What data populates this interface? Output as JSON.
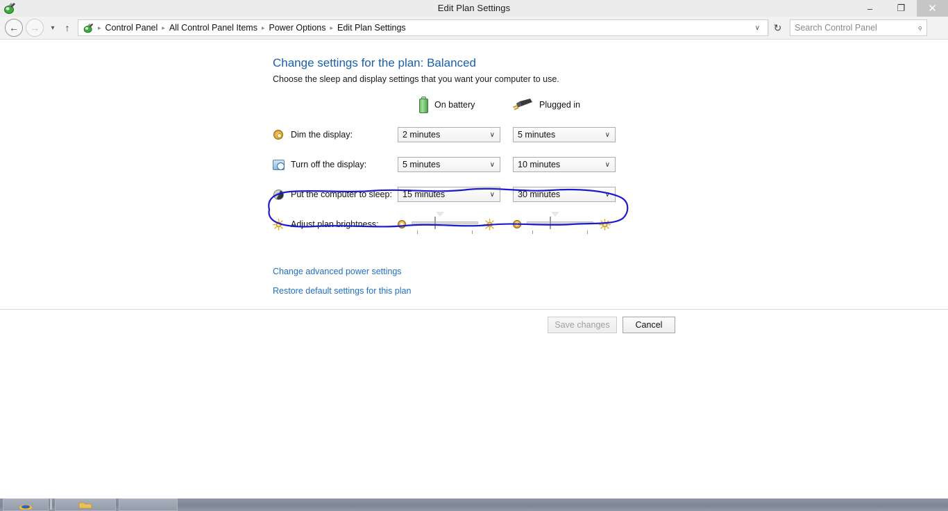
{
  "window": {
    "title": "Edit Plan Settings",
    "icon": "power-options-icon",
    "minimize_label": "–",
    "maximize_label": "❐",
    "close_label": "✕"
  },
  "navbar": {
    "back_label": "←",
    "forward_label": "→",
    "recent_caret_label": "▾",
    "up_label": "↑",
    "breadcrumb_icon": "power-options-icon",
    "breadcrumbs": [
      "Control Panel",
      "All Control Panel Items",
      "Power Options",
      "Edit Plan Settings"
    ],
    "separator": "▸",
    "address_dropdown_label": "∨",
    "refresh_label": "↻",
    "search_placeholder": "Search Control Panel",
    "search_value": "",
    "search_icon": "search-icon"
  },
  "content": {
    "heading": "Change settings for the plan: Balanced",
    "subheading": "Choose the sleep and display settings that you want your computer to use.",
    "columns": [
      {
        "label": "On battery",
        "icon": "battery-icon"
      },
      {
        "label": "Plugged in",
        "icon": "power-plug-icon"
      }
    ],
    "rows": [
      {
        "label": "Dim the display:",
        "icon": "dim-display-icon",
        "battery_value": "2 minutes",
        "plugged_value": "5 minutes"
      },
      {
        "label": "Turn off the display:",
        "icon": "turn-off-display-icon",
        "battery_value": "5 minutes",
        "plugged_value": "10 minutes"
      },
      {
        "label": "Put the computer to sleep:",
        "icon": "sleep-icon",
        "battery_value": "15 minutes",
        "plugged_value": "30 minutes"
      }
    ],
    "brightness": {
      "label": "Adjust plan brightness:",
      "icon": "brightness-icon",
      "low_icon": "brightness-low-icon",
      "high_icon": "brightness-high-icon",
      "battery_percent": 40,
      "plugged_percent": 40
    },
    "links": [
      "Change advanced power settings",
      "Restore default settings for this plan"
    ],
    "buttons": {
      "save": {
        "label": "Save changes",
        "disabled": true
      },
      "cancel": {
        "label": "Cancel",
        "disabled": false
      }
    },
    "annotation": {
      "shape": "hand-drawn-ellipse",
      "color": "#1a1ad0",
      "targets": "Turn off the display row"
    },
    "dropdown_arrow": "∨"
  },
  "taskbar": {
    "buttons": [
      "taskbar-item-1",
      "taskbar-item-2",
      "taskbar-item-3"
    ]
  }
}
